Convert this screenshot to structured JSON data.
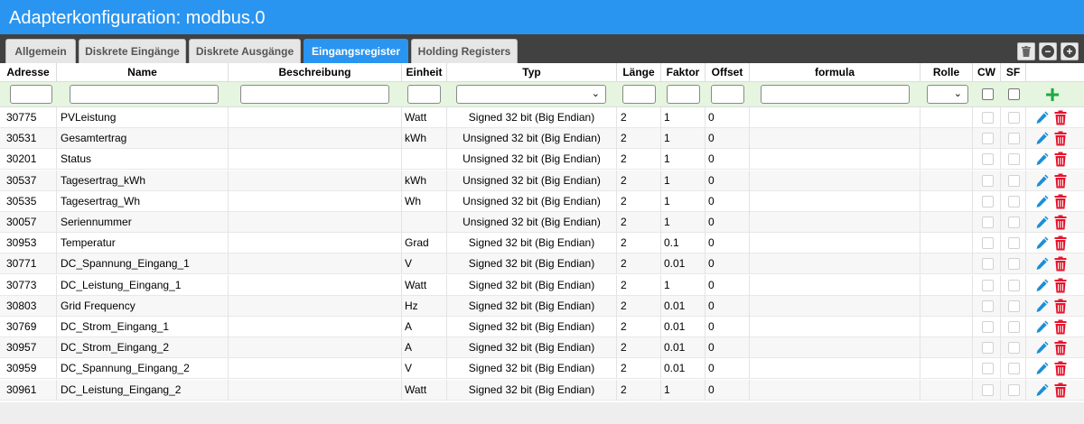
{
  "window": {
    "title": "Adapterkonfiguration: modbus.0"
  },
  "tabs": [
    {
      "label": "Allgemein",
      "active": false
    },
    {
      "label": "Diskrete Eingänge",
      "active": false
    },
    {
      "label": "Diskrete Ausgänge",
      "active": false
    },
    {
      "label": "Eingangsregister",
      "active": true
    },
    {
      "label": "Holding Registers",
      "active": false
    }
  ],
  "toolbar": {
    "icons": [
      "trash-icon",
      "minus-circle-icon",
      "plus-circle-icon"
    ]
  },
  "table": {
    "columns": [
      "Adresse",
      "Name",
      "Beschreibung",
      "Einheit",
      "Typ",
      "Länge",
      "Faktor",
      "Offset",
      "formula",
      "Rolle",
      "CW",
      "SF"
    ],
    "filter_values": {
      "adresse": "",
      "name": "",
      "beschreibung": "",
      "einheit": "",
      "typ": "",
      "laenge": "",
      "faktor": "",
      "offset": "",
      "formula": "",
      "rolle": ""
    },
    "rows": [
      {
        "adresse": "30775",
        "name": "PVLeistung",
        "beschreibung": "",
        "einheit": "Watt",
        "typ": "Signed 32 bit (Big Endian)",
        "laenge": "2",
        "faktor": "1",
        "offset": "0",
        "formula": "",
        "rolle": ""
      },
      {
        "adresse": "30531",
        "name": "Gesamtertrag",
        "beschreibung": "",
        "einheit": "kWh",
        "typ": "Unsigned 32 bit (Big Endian)",
        "laenge": "2",
        "faktor": "1",
        "offset": "0",
        "formula": "",
        "rolle": ""
      },
      {
        "adresse": "30201",
        "name": "Status",
        "beschreibung": "",
        "einheit": "",
        "typ": "Unsigned 32 bit (Big Endian)",
        "laenge": "2",
        "faktor": "1",
        "offset": "0",
        "formula": "",
        "rolle": ""
      },
      {
        "adresse": "30537",
        "name": "Tagesertrag_kWh",
        "beschreibung": "",
        "einheit": "kWh",
        "typ": "Unsigned 32 bit (Big Endian)",
        "laenge": "2",
        "faktor": "1",
        "offset": "0",
        "formula": "",
        "rolle": ""
      },
      {
        "adresse": "30535",
        "name": "Tagesertrag_Wh",
        "beschreibung": "",
        "einheit": "Wh",
        "typ": "Unsigned 32 bit (Big Endian)",
        "laenge": "2",
        "faktor": "1",
        "offset": "0",
        "formula": "",
        "rolle": ""
      },
      {
        "adresse": "30057",
        "name": "Seriennummer",
        "beschreibung": "",
        "einheit": "",
        "typ": "Unsigned 32 bit (Big Endian)",
        "laenge": "2",
        "faktor": "1",
        "offset": "0",
        "formula": "",
        "rolle": ""
      },
      {
        "adresse": "30953",
        "name": "Temperatur",
        "beschreibung": "",
        "einheit": "Grad",
        "typ": "Signed 32 bit (Big Endian)",
        "laenge": "2",
        "faktor": "0.1",
        "offset": "0",
        "formula": "",
        "rolle": ""
      },
      {
        "adresse": "30771",
        "name": "DC_Spannung_Eingang_1",
        "beschreibung": "",
        "einheit": "V",
        "typ": "Signed 32 bit (Big Endian)",
        "laenge": "2",
        "faktor": "0.01",
        "offset": "0",
        "formula": "",
        "rolle": ""
      },
      {
        "adresse": "30773",
        "name": "DC_Leistung_Eingang_1",
        "beschreibung": "",
        "einheit": "Watt",
        "typ": "Signed 32 bit (Big Endian)",
        "laenge": "2",
        "faktor": "1",
        "offset": "0",
        "formula": "",
        "rolle": ""
      },
      {
        "adresse": "30803",
        "name": "Grid Frequency",
        "beschreibung": "",
        "einheit": "Hz",
        "typ": "Signed 32 bit (Big Endian)",
        "laenge": "2",
        "faktor": "0.01",
        "offset": "0",
        "formula": "",
        "rolle": ""
      },
      {
        "adresse": "30769",
        "name": "DC_Strom_Eingang_1",
        "beschreibung": "",
        "einheit": "A",
        "typ": "Signed 32 bit (Big Endian)",
        "laenge": "2",
        "faktor": "0.01",
        "offset": "0",
        "formula": "",
        "rolle": ""
      },
      {
        "adresse": "30957",
        "name": "DC_Strom_Eingang_2",
        "beschreibung": "",
        "einheit": "A",
        "typ": "Signed 32 bit (Big Endian)",
        "laenge": "2",
        "faktor": "0.01",
        "offset": "0",
        "formula": "",
        "rolle": ""
      },
      {
        "adresse": "30959",
        "name": "DC_Spannung_Eingang_2",
        "beschreibung": "",
        "einheit": "V",
        "typ": "Signed 32 bit (Big Endian)",
        "laenge": "2",
        "faktor": "0.01",
        "offset": "0",
        "formula": "",
        "rolle": ""
      },
      {
        "adresse": "30961",
        "name": "DC_Leistung_Eingang_2",
        "beschreibung": "",
        "einheit": "Watt",
        "typ": "Signed 32 bit (Big Endian)",
        "laenge": "2",
        "faktor": "1",
        "offset": "0",
        "formula": "",
        "rolle": ""
      }
    ]
  },
  "colors": {
    "accent": "#2a95f0",
    "add": "#22a844",
    "edit": "#1a8fd8",
    "delete": "#e8142d"
  }
}
